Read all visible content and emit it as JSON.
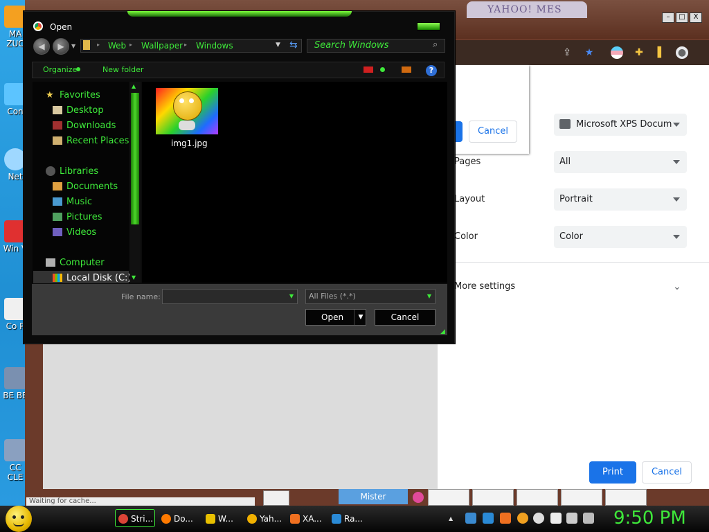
{
  "desktop": {
    "icons": [
      "MA ZUC",
      "Con",
      "Net",
      "Win V",
      "Co P",
      "BE BE",
      "CC CLE"
    ]
  },
  "browser": {
    "tab_title": "YAHOO! MES",
    "window_buttons": [
      "–",
      "□",
      "X"
    ]
  },
  "print_preview": {
    "cancel_top_label": "Cancel",
    "destination_value": "Microsoft XPS Docum",
    "pages_label": "Pages",
    "pages_value": "All",
    "layout_label": "Layout",
    "layout_value": "Portrait",
    "color_label": "Color",
    "color_value": "Color",
    "more_settings_label": "More settings",
    "print_label": "Print",
    "cancel_label": "Cancel"
  },
  "open_dialog": {
    "title": "Open",
    "breadcrumbs": [
      "Web",
      "Wallpaper",
      "Windows"
    ],
    "search_placeholder": "Search Windows",
    "organize_label": "Organize",
    "new_folder_label": "New folder",
    "nav": {
      "favorites": "Favorites",
      "desktop": "Desktop",
      "downloads": "Downloads",
      "recent_places": "Recent Places",
      "libraries": "Libraries",
      "documents": "Documents",
      "music": "Music",
      "pictures": "Pictures",
      "videos": "Videos",
      "computer": "Computer",
      "local_disk": "Local Disk (C:)"
    },
    "file": {
      "name": "img1.jpg"
    },
    "file_name_label": "File name:",
    "file_name_value": "",
    "filter_value": "All Files (*.*)",
    "open_label": "Open",
    "cancel_label": "Cancel"
  },
  "bottom_strip": {
    "status_text": "Waiting for cache...",
    "mister_label": "Mister"
  },
  "taskbar": {
    "items": [
      {
        "label": "Stri...",
        "color": "#db4437"
      },
      {
        "label": "Do...",
        "color": "#ff7a00"
      },
      {
        "label": "W...",
        "color": "#e8c000"
      },
      {
        "label": "Yah...",
        "color": "#f0b000"
      },
      {
        "label": "XA...",
        "color": "#f07020"
      },
      {
        "label": "Ra...",
        "color": "#2a8ad6"
      }
    ],
    "clock": "9:50 PM"
  },
  "colors": {
    "accent_green": "#3ee83a",
    "chrome_blue": "#1a73e8"
  }
}
